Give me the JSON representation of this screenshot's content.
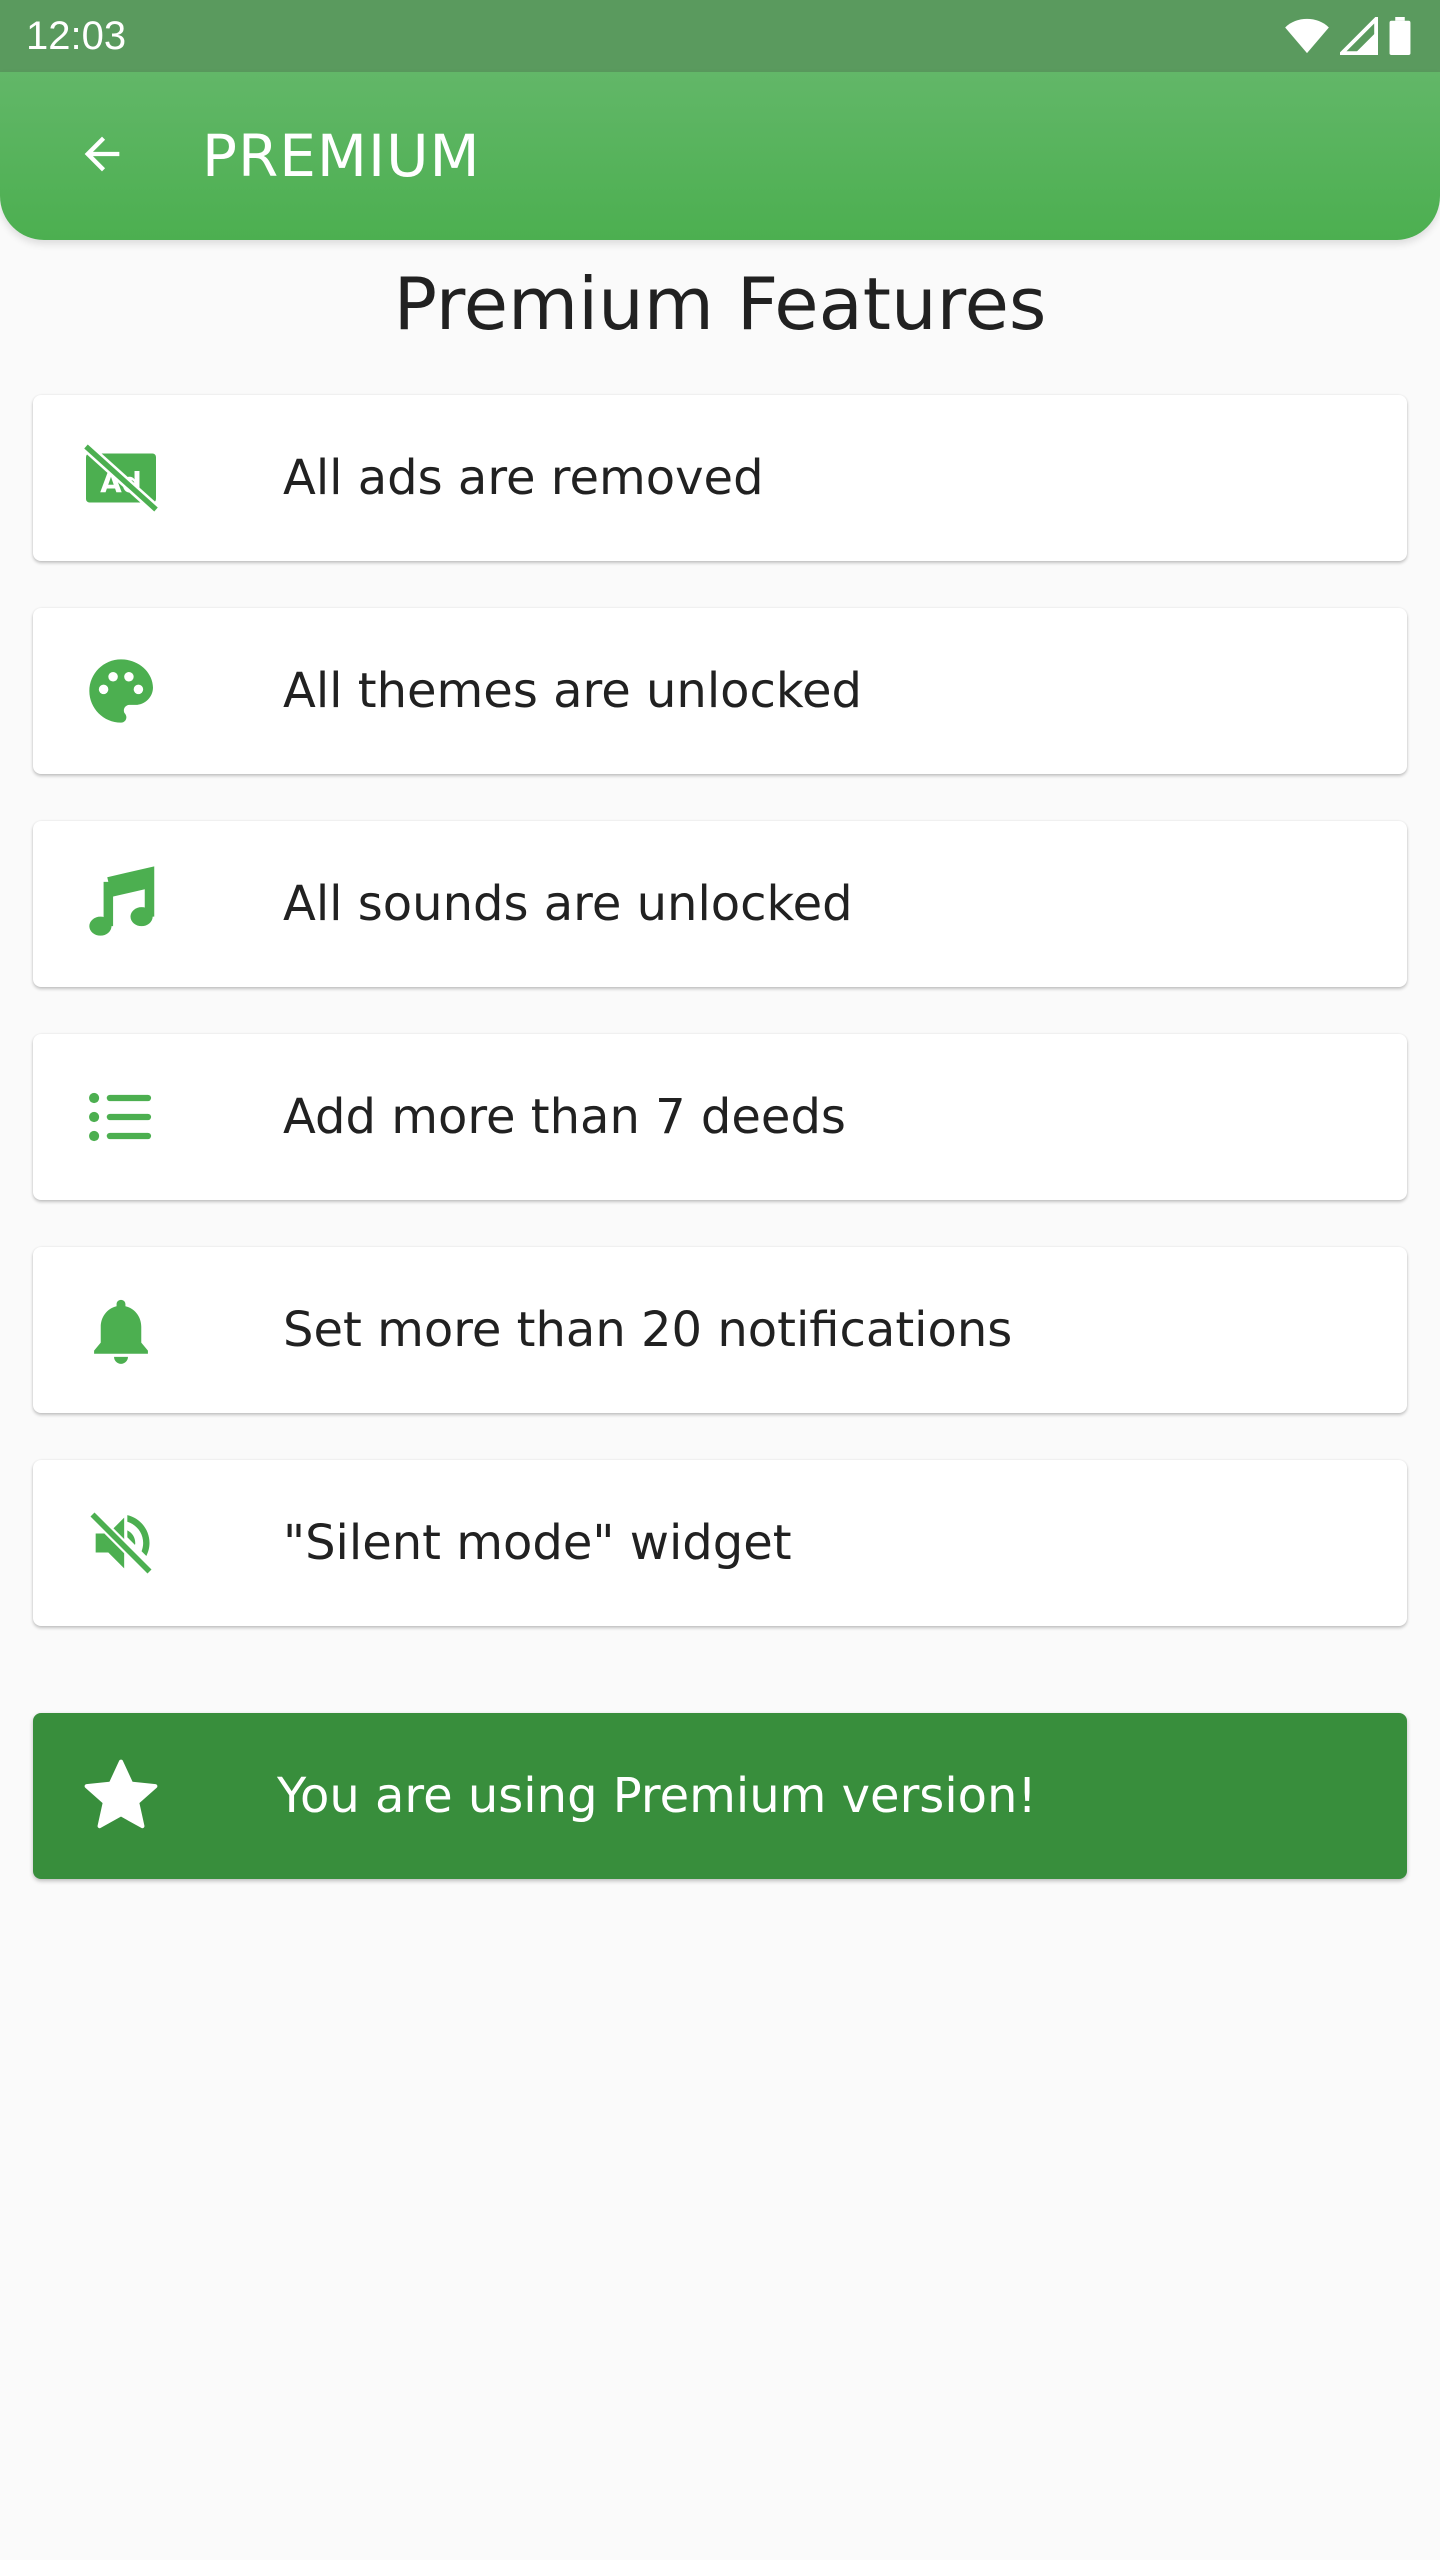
{
  "status_bar": {
    "time": "12:03",
    "icons": [
      "wifi-icon",
      "signal-icon",
      "battery-icon"
    ]
  },
  "app_bar": {
    "title": "PREMIUM",
    "back_icon": "arrow-back-icon",
    "color": "#4caf50"
  },
  "page": {
    "title": "Premium Features"
  },
  "features": [
    {
      "icon": "ads-off-icon",
      "label": "All ads are removed"
    },
    {
      "icon": "palette-icon",
      "label": "All themes are unlocked"
    },
    {
      "icon": "music-note-icon",
      "label": "All sounds are unlocked"
    },
    {
      "icon": "list-icon",
      "label": "Add more than 7 deeds"
    },
    {
      "icon": "bell-icon",
      "label": "Set more than 20 notifications"
    },
    {
      "icon": "volume-off-icon",
      "label": "\"Silent mode\" widget"
    }
  ],
  "premium_status": {
    "icon": "star-icon",
    "label": "You are using Premium version!",
    "color": "#388e3c"
  },
  "colors": {
    "accent": "#4caf50",
    "background": "#fafafa"
  }
}
